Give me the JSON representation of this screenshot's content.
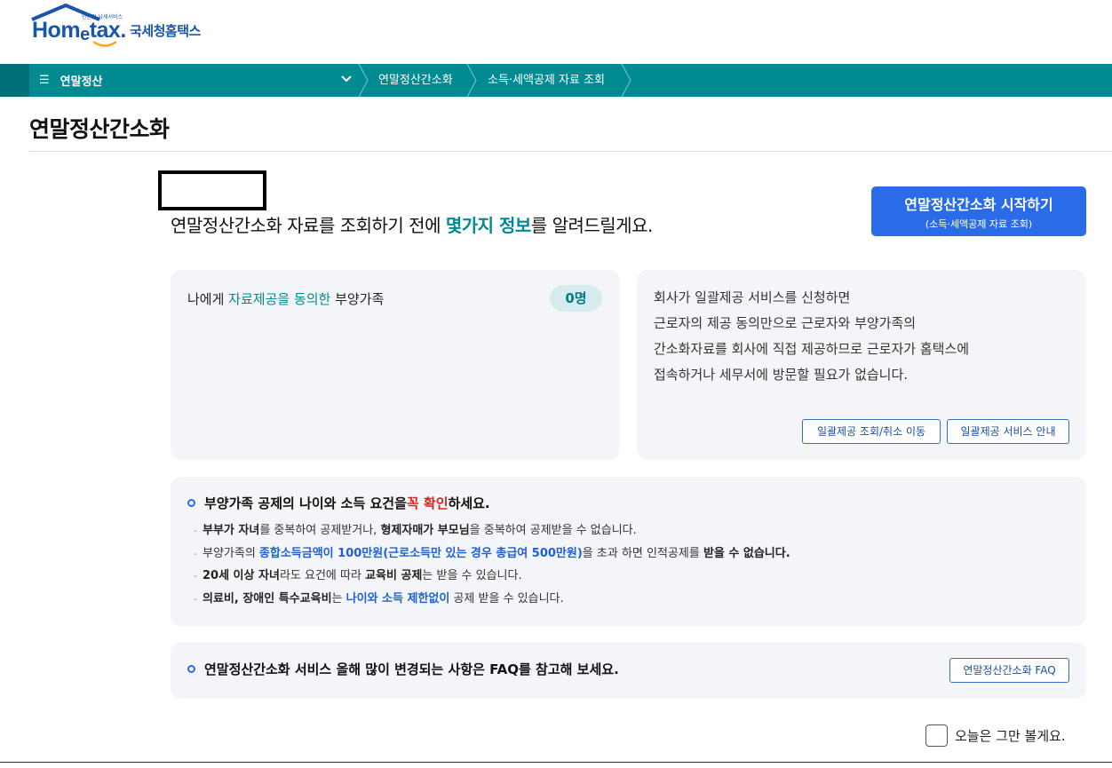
{
  "header": {
    "logo_text_pre": "Hom",
    "logo_text_e": "e",
    "logo_text_post": "tax.",
    "logo_tagline": "민원인 납세서비스",
    "logo_korean": "국세청홈택스",
    "brand_color": "#1a56a8"
  },
  "nav": {
    "menu_icon": "hamburger-icon",
    "menu_label": "연말정산",
    "breadcrumbs": [
      "연말정산간소화",
      "소득·세액공제 자료 조회"
    ],
    "bar_color": "#008b93"
  },
  "page": {
    "title": "연말정산간소화"
  },
  "intro": {
    "prefix": "연말정산간소화 자료를 조회하기 전에 ",
    "highlight": "몇가지 정보",
    "suffix": "를 알려드릴게요."
  },
  "start_button": {
    "line1": "연말정산간소화 시작하기",
    "line2": "(소득·세액공제 자료 조회)",
    "color": "#2a6ce8"
  },
  "consent_card": {
    "label_prefix": "나에게 ",
    "label_highlight": "자료제공을 동의한",
    "label_suffix": " 부양가족",
    "count": "0명"
  },
  "bulk_card": {
    "lines": [
      "회사가 일괄제공 서비스를 신청하면",
      "근로자의 제공 동의만으로 근로자와 부양가족의",
      "간소화자료를 회사에 직접 제공하므로 근로자가 홈택스에",
      "접속하거나 세무서에 방문할 필요가 없습니다."
    ],
    "lookup_button": "일괄제공 조회/취소 이동",
    "guide_button": "일괄제공 서비스 안내"
  },
  "rules_card": {
    "head_prefix": "부양가족 공제의 나이와 소득 요건을 ",
    "head_red": "꼭 확인",
    "head_suffix": "하세요.",
    "items": [
      {
        "a": "부부가 자녀",
        "b": "를 중복하여 공제받거나, ",
        "c": "형제자매가 부모님",
        "d": "을 중복하여 공제받을 수 없습니다."
      },
      {
        "a": "부양가족의 ",
        "b": "종합소득금액이 100만원(근로소득만 있는 경우 총급여 500만원)",
        "c": "을 초과 하면 인적공제를 ",
        "d": "받을 수 없습니다."
      },
      {
        "a": "20세 이상 자녀",
        "b": "라도 요건에 따라 ",
        "c": "교육비 공제",
        "d": "는 받을 수 있습니다."
      },
      {
        "a": "의료비, 장애인 특수교육비",
        "b": "는 ",
        "c": "나이와 소득 제한없이",
        "d": " 공제 받을 수 있습니다."
      }
    ]
  },
  "faq_card": {
    "text": "연말정산간소화 서비스 올해 많이 변경되는 사항은 FAQ를 참고해 보세요.",
    "button": "연말정산간소화 FAQ"
  },
  "footer": {
    "dismiss_label": "오늘은 그만 볼게요."
  }
}
